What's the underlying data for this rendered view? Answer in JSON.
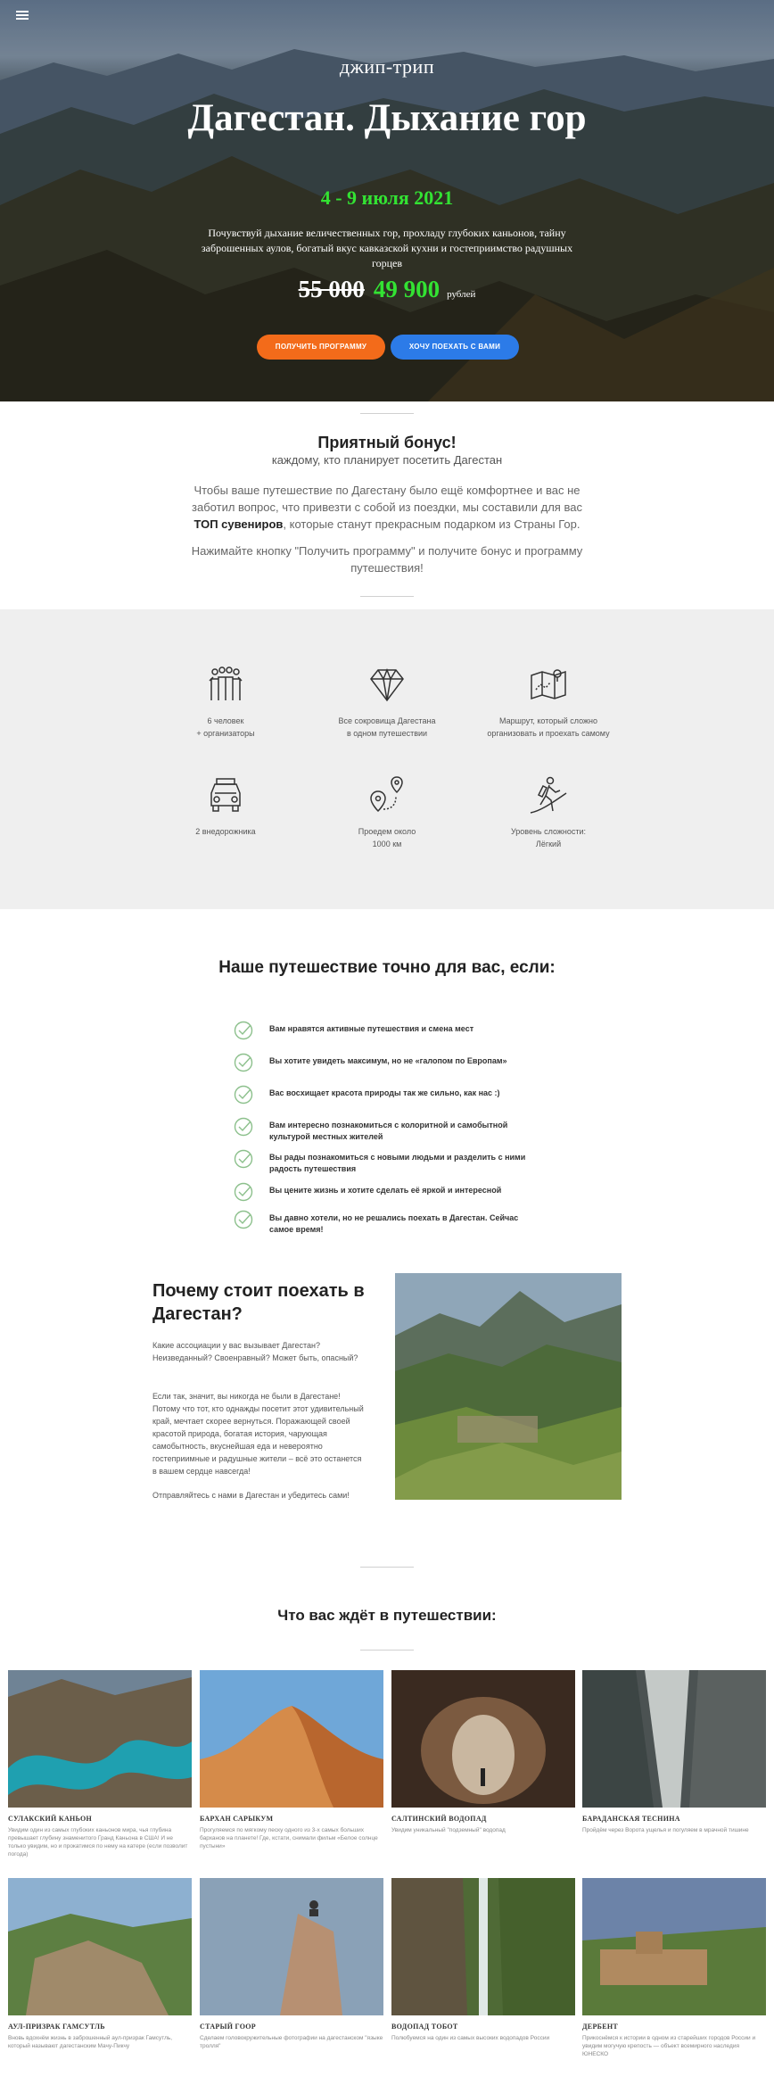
{
  "hero": {
    "subtitle": "джип-трип",
    "title": "Дагестан. Дыхание гор",
    "dates": "4 - 9 июля 2021",
    "description": "Почувствуй дыхание величественных гор, прохладу глубоких каньонов, тайну заброшенных аулов, богатый вкус кавказской кухни и гостеприимство радушных горцев",
    "old_price": "55 000",
    "new_price": "49 900",
    "currency": "рублей",
    "btn_program": "ПОЛУЧИТЬ ПРОГРАММУ",
    "btn_go": "ХОЧУ ПОЕХАТЬ С ВАМИ",
    "menu_icon": "hamburger-icon"
  },
  "bonus": {
    "title": "Приятный бонус!",
    "subtitle": "каждому, кто планирует посетить Дагестан",
    "text_1": "Чтобы ваше путешествие по Дагестану было ещё комфортнее и вас не заботил вопрос, что привезти с собой из поездки, мы составили для вас ",
    "text_bold": "ТОП сувениров",
    "text_2": ", которые станут прекрасным подарком из Страны Гор.",
    "cta": "Нажимайте кнопку \"Получить программу\" и получите бонус и программу путешествия!"
  },
  "features": [
    {
      "icon": "group-icon",
      "line1": "6 человек",
      "line2": "+ организаторы"
    },
    {
      "icon": "diamond-icon",
      "line1": "Все сокровища Дагестана",
      "line2": "в одном путешествии"
    },
    {
      "icon": "map-icon",
      "line1": "Маршрут, который сложно",
      "line2": "организовать и проехать самому"
    },
    {
      "icon": "jeep-icon",
      "line1": "2 внедорожника",
      "line2": ""
    },
    {
      "icon": "route-icon",
      "line1": "Проедем около",
      "line2": "1000 км"
    },
    {
      "icon": "hiker-icon",
      "line1": "Уровень сложности:",
      "line2": "Лёгкий"
    }
  ],
  "foryou": {
    "title": "Наше путешествие точно для вас, если:",
    "items": [
      "Вам нравятся активные путешествия и смена мест",
      "Вы хотите увидеть максимум, но не «галопом по Европам»",
      "Вас восхищает красота природы так же сильно, как нас :)",
      "Вам интересно познакомиться с колоритной и самобытной культурой местных жителей",
      "Вы рады познакомиться с новыми людьми и разделить с ними радость путешествия",
      "Вы цените жизнь и хотите сделать её яркой и интересной",
      "Вы давно хотели, но не решались поехать в Дагестан. Сейчас самое время!"
    ]
  },
  "why": {
    "title": "Почему стоит поехать в Дагестан?",
    "p1": "Какие ассоциации у вас вызывает Дагестан? Неизведанный? Своенравный? Может быть, опасный?",
    "p2": "Если так, значит, вы никогда не были в Дагестане! Потому что тот, кто однажды посетит этот удивительный край, мечтает скорее вернуться. Поражающей своей красотой природа, богатая история, чарующая самобытность, вкуснейшая еда и невероятно гостеприимные и радушные жители – всё это останется в вашем сердце навсегда!",
    "p3": "Отправляйтесь с нами в Дагестан и убедитесь сами!"
  },
  "awaits": {
    "title": "Что вас ждёт в путешествии:",
    "cards": [
      {
        "title": "СУЛАКСКИЙ КАНЬОН",
        "desc": "Увидим один из самых глубоких каньонов мира, чья глубина превышает глубину знаменитого Гранд Каньона в США! И не только увидим, но и прокатимся по нему на катере (если позволит погода)"
      },
      {
        "title": "БАРХАН САРЫКУМ",
        "desc": "Прогуляемся по мягкому песку одного из 3-х самых больших барханов на планете! Где, кстати, снимали фильм «Белое солнце пустыни»"
      },
      {
        "title": "САЛТИНСКИЙ ВОДОПАД",
        "desc": "Увидим уникальный \"подземный\" водопад"
      },
      {
        "title": "БАРАДАНСКАЯ ТЕСНИНА",
        "desc": "Пройдём через Ворота ущелья и погуляем в мрачной тишине"
      },
      {
        "title": "АУЛ-ПРИЗРАК ГАМСУТЛЬ",
        "desc": "Вновь вдохнём жизнь в заброшенный аул-призрак Гамсутль, который называют дагестанским Мачу-Пикчу"
      },
      {
        "title": "СТАРЫЙ ГООР",
        "desc": "Сделаем головокружительные фотографии на дагестанском \"языке тролля\""
      },
      {
        "title": "ВОДОПАД ТОБОТ",
        "desc": "Полюбуемся на один из самых высоких водопадов России"
      },
      {
        "title": "ДЕРБЕНТ",
        "desc": "Прикоснёмся к истории в одном из старейших городов России и увидим могучую крепость — объект всемирного наследия ЮНЕСКО"
      }
    ]
  }
}
